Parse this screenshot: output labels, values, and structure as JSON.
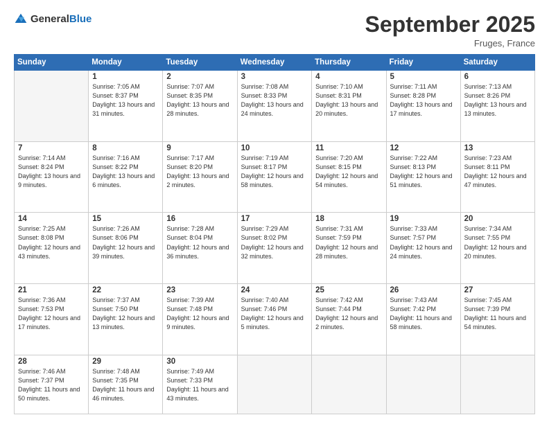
{
  "header": {
    "logo_general": "General",
    "logo_blue": "Blue",
    "month_title": "September 2025",
    "location": "Fruges, France"
  },
  "weekdays": [
    "Sunday",
    "Monday",
    "Tuesday",
    "Wednesday",
    "Thursday",
    "Friday",
    "Saturday"
  ],
  "weeks": [
    [
      {
        "day": "",
        "sunrise": "",
        "sunset": "",
        "daylight": ""
      },
      {
        "day": "1",
        "sunrise": "Sunrise: 7:05 AM",
        "sunset": "Sunset: 8:37 PM",
        "daylight": "Daylight: 13 hours and 31 minutes."
      },
      {
        "day": "2",
        "sunrise": "Sunrise: 7:07 AM",
        "sunset": "Sunset: 8:35 PM",
        "daylight": "Daylight: 13 hours and 28 minutes."
      },
      {
        "day": "3",
        "sunrise": "Sunrise: 7:08 AM",
        "sunset": "Sunset: 8:33 PM",
        "daylight": "Daylight: 13 hours and 24 minutes."
      },
      {
        "day": "4",
        "sunrise": "Sunrise: 7:10 AM",
        "sunset": "Sunset: 8:31 PM",
        "daylight": "Daylight: 13 hours and 20 minutes."
      },
      {
        "day": "5",
        "sunrise": "Sunrise: 7:11 AM",
        "sunset": "Sunset: 8:28 PM",
        "daylight": "Daylight: 13 hours and 17 minutes."
      },
      {
        "day": "6",
        "sunrise": "Sunrise: 7:13 AM",
        "sunset": "Sunset: 8:26 PM",
        "daylight": "Daylight: 13 hours and 13 minutes."
      }
    ],
    [
      {
        "day": "7",
        "sunrise": "Sunrise: 7:14 AM",
        "sunset": "Sunset: 8:24 PM",
        "daylight": "Daylight: 13 hours and 9 minutes."
      },
      {
        "day": "8",
        "sunrise": "Sunrise: 7:16 AM",
        "sunset": "Sunset: 8:22 PM",
        "daylight": "Daylight: 13 hours and 6 minutes."
      },
      {
        "day": "9",
        "sunrise": "Sunrise: 7:17 AM",
        "sunset": "Sunset: 8:20 PM",
        "daylight": "Daylight: 13 hours and 2 minutes."
      },
      {
        "day": "10",
        "sunrise": "Sunrise: 7:19 AM",
        "sunset": "Sunset: 8:17 PM",
        "daylight": "Daylight: 12 hours and 58 minutes."
      },
      {
        "day": "11",
        "sunrise": "Sunrise: 7:20 AM",
        "sunset": "Sunset: 8:15 PM",
        "daylight": "Daylight: 12 hours and 54 minutes."
      },
      {
        "day": "12",
        "sunrise": "Sunrise: 7:22 AM",
        "sunset": "Sunset: 8:13 PM",
        "daylight": "Daylight: 12 hours and 51 minutes."
      },
      {
        "day": "13",
        "sunrise": "Sunrise: 7:23 AM",
        "sunset": "Sunset: 8:11 PM",
        "daylight": "Daylight: 12 hours and 47 minutes."
      }
    ],
    [
      {
        "day": "14",
        "sunrise": "Sunrise: 7:25 AM",
        "sunset": "Sunset: 8:08 PM",
        "daylight": "Daylight: 12 hours and 43 minutes."
      },
      {
        "day": "15",
        "sunrise": "Sunrise: 7:26 AM",
        "sunset": "Sunset: 8:06 PM",
        "daylight": "Daylight: 12 hours and 39 minutes."
      },
      {
        "day": "16",
        "sunrise": "Sunrise: 7:28 AM",
        "sunset": "Sunset: 8:04 PM",
        "daylight": "Daylight: 12 hours and 36 minutes."
      },
      {
        "day": "17",
        "sunrise": "Sunrise: 7:29 AM",
        "sunset": "Sunset: 8:02 PM",
        "daylight": "Daylight: 12 hours and 32 minutes."
      },
      {
        "day": "18",
        "sunrise": "Sunrise: 7:31 AM",
        "sunset": "Sunset: 7:59 PM",
        "daylight": "Daylight: 12 hours and 28 minutes."
      },
      {
        "day": "19",
        "sunrise": "Sunrise: 7:33 AM",
        "sunset": "Sunset: 7:57 PM",
        "daylight": "Daylight: 12 hours and 24 minutes."
      },
      {
        "day": "20",
        "sunrise": "Sunrise: 7:34 AM",
        "sunset": "Sunset: 7:55 PM",
        "daylight": "Daylight: 12 hours and 20 minutes."
      }
    ],
    [
      {
        "day": "21",
        "sunrise": "Sunrise: 7:36 AM",
        "sunset": "Sunset: 7:53 PM",
        "daylight": "Daylight: 12 hours and 17 minutes."
      },
      {
        "day": "22",
        "sunrise": "Sunrise: 7:37 AM",
        "sunset": "Sunset: 7:50 PM",
        "daylight": "Daylight: 12 hours and 13 minutes."
      },
      {
        "day": "23",
        "sunrise": "Sunrise: 7:39 AM",
        "sunset": "Sunset: 7:48 PM",
        "daylight": "Daylight: 12 hours and 9 minutes."
      },
      {
        "day": "24",
        "sunrise": "Sunrise: 7:40 AM",
        "sunset": "Sunset: 7:46 PM",
        "daylight": "Daylight: 12 hours and 5 minutes."
      },
      {
        "day": "25",
        "sunrise": "Sunrise: 7:42 AM",
        "sunset": "Sunset: 7:44 PM",
        "daylight": "Daylight: 12 hours and 2 minutes."
      },
      {
        "day": "26",
        "sunrise": "Sunrise: 7:43 AM",
        "sunset": "Sunset: 7:42 PM",
        "daylight": "Daylight: 11 hours and 58 minutes."
      },
      {
        "day": "27",
        "sunrise": "Sunrise: 7:45 AM",
        "sunset": "Sunset: 7:39 PM",
        "daylight": "Daylight: 11 hours and 54 minutes."
      }
    ],
    [
      {
        "day": "28",
        "sunrise": "Sunrise: 7:46 AM",
        "sunset": "Sunset: 7:37 PM",
        "daylight": "Daylight: 11 hours and 50 minutes."
      },
      {
        "day": "29",
        "sunrise": "Sunrise: 7:48 AM",
        "sunset": "Sunset: 7:35 PM",
        "daylight": "Daylight: 11 hours and 46 minutes."
      },
      {
        "day": "30",
        "sunrise": "Sunrise: 7:49 AM",
        "sunset": "Sunset: 7:33 PM",
        "daylight": "Daylight: 11 hours and 43 minutes."
      },
      {
        "day": "",
        "sunrise": "",
        "sunset": "",
        "daylight": ""
      },
      {
        "day": "",
        "sunrise": "",
        "sunset": "",
        "daylight": ""
      },
      {
        "day": "",
        "sunrise": "",
        "sunset": "",
        "daylight": ""
      },
      {
        "day": "",
        "sunrise": "",
        "sunset": "",
        "daylight": ""
      }
    ]
  ]
}
